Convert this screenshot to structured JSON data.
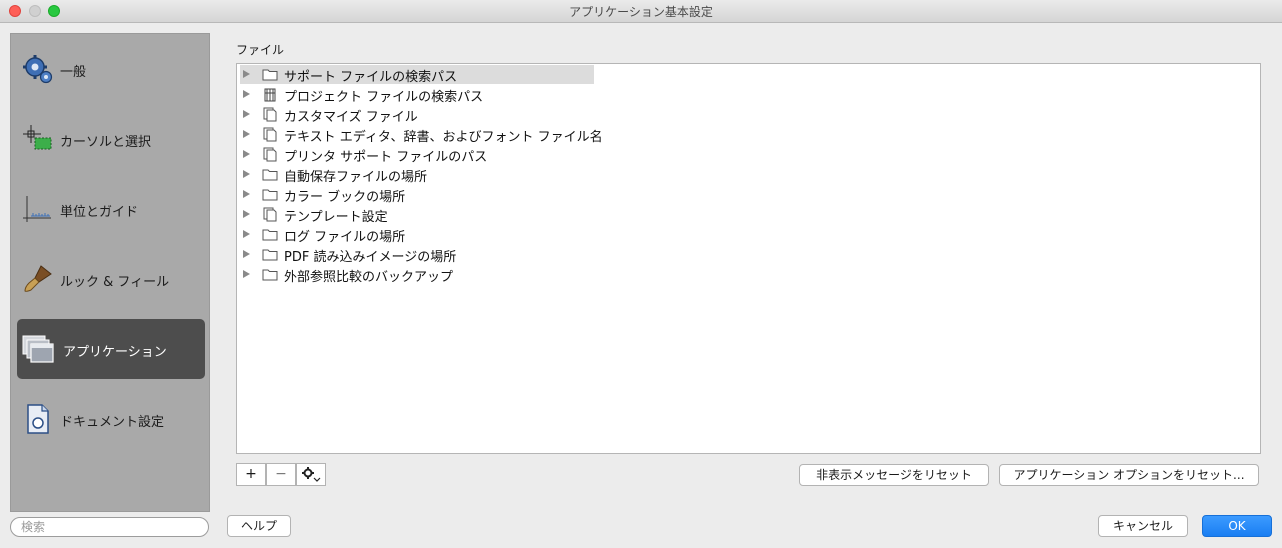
{
  "window": {
    "title": "アプリケーション基本設定"
  },
  "sidebar": {
    "items": [
      {
        "label": "一般",
        "icon": "gear-icon"
      },
      {
        "label": "カーソルと選択",
        "icon": "cursor-selection-icon"
      },
      {
        "label": "単位とガイド",
        "icon": "ruler-guide-icon"
      },
      {
        "label": "ルック & フィール",
        "icon": "brush-icon"
      },
      {
        "label": "アプリケーション",
        "icon": "windows-icon",
        "selected": true
      },
      {
        "label": "ドキュメント設定",
        "icon": "document-icon"
      }
    ],
    "search_placeholder": "検索"
  },
  "main": {
    "section_label": "ファイル",
    "tree": [
      {
        "label": "サポート ファイルの検索パス",
        "icon": "folder-icon"
      },
      {
        "label": "プロジェクト ファイルの検索パス",
        "icon": "project-icon"
      },
      {
        "label": "カスタマイズ ファイル",
        "icon": "file-icon"
      },
      {
        "label": "テキスト エディタ、辞書、およびフォント ファイル名",
        "icon": "file-icon"
      },
      {
        "label": "プリンタ サポート ファイルのパス",
        "icon": "file-icon"
      },
      {
        "label": "自動保存ファイルの場所",
        "icon": "folder-icon"
      },
      {
        "label": "カラー ブックの場所",
        "icon": "folder-icon"
      },
      {
        "label": "テンプレート設定",
        "icon": "file-icon"
      },
      {
        "label": "ログ ファイルの場所",
        "icon": "folder-icon"
      },
      {
        "label": "PDF 読み込みイメージの場所",
        "icon": "folder-icon"
      },
      {
        "label": "外部参照比較のバックアップ",
        "icon": "folder-icon"
      }
    ],
    "add_label": "+",
    "remove_label": "−",
    "reset_messages_label": "非表示メッセージをリセット",
    "reset_options_label": "アプリケーション オプションをリセット..."
  },
  "footer": {
    "help_label": "ヘルプ",
    "cancel_label": "キャンセル",
    "ok_label": "OK"
  }
}
